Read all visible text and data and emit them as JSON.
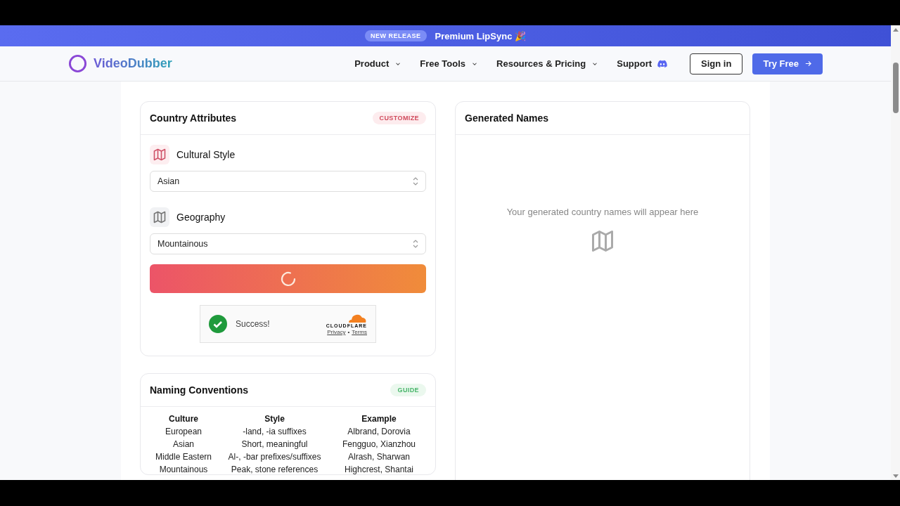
{
  "banner": {
    "badge": "NEW RELEASE",
    "text": "Premium LipSync 🎉"
  },
  "nav": {
    "logo": "VideoDubber",
    "menus": [
      {
        "label": "Product",
        "dropdown": true
      },
      {
        "label": "Free Tools",
        "dropdown": true
      },
      {
        "label": "Resources & Pricing",
        "dropdown": true
      },
      {
        "label": "Support",
        "dropdown": false
      }
    ],
    "sign_in": "Sign in",
    "try_free": "Try Free"
  },
  "attributes_card": {
    "title": "Country Attributes",
    "badge": "CUSTOMIZE",
    "fields": [
      {
        "label": "Cultural Style",
        "value": "Asian",
        "accent": true
      },
      {
        "label": "Geography",
        "value": "Mountainous",
        "accent": false
      }
    ],
    "generate_loading": true,
    "captcha": {
      "status": "Success!",
      "brand": "CLOUDFLARE",
      "links": [
        "Privacy",
        "Terms"
      ],
      "separator": "•"
    }
  },
  "names_card": {
    "title": "Generated Names",
    "empty_text": "Your generated country names will appear here"
  },
  "conventions_card": {
    "title": "Naming Conventions",
    "badge": "GUIDE",
    "columns": [
      "Culture",
      "Style",
      "Example"
    ],
    "rows": [
      [
        "European",
        "-land, -ia suffixes",
        "Albrand, Dorovia"
      ],
      [
        "Asian",
        "Short, meaningful",
        "Fengguo, Xianzhou"
      ],
      [
        "Middle Eastern",
        "Al-, -bar prefixes/suffixes",
        "Alrash, Sharwan"
      ],
      [
        "Mountainous",
        "Peak, stone references",
        "Highcrest, Shantai"
      ]
    ]
  }
}
